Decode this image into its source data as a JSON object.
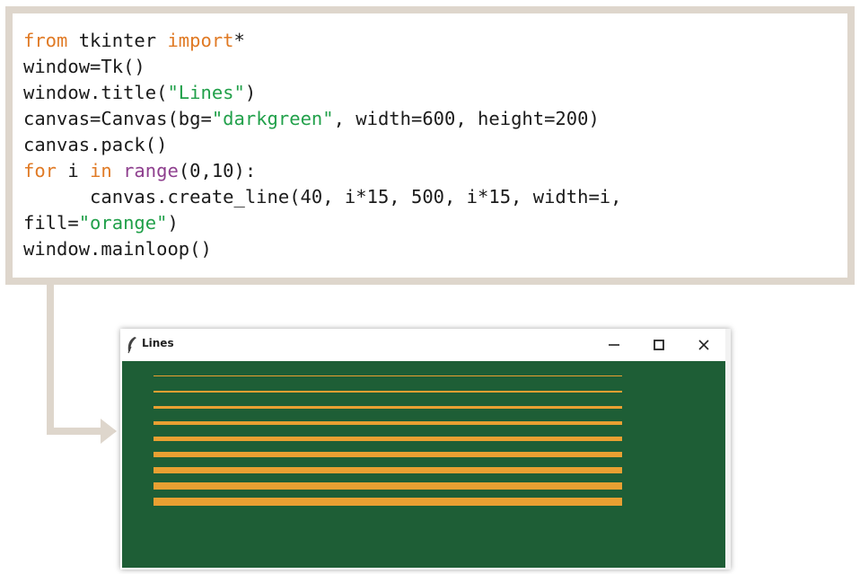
{
  "code": {
    "lines": [
      [
        {
          "t": "from",
          "c": "kw"
        },
        {
          "t": " tkinter "
        },
        {
          "t": "import",
          "c": "kw"
        },
        {
          "t": "*"
        }
      ],
      [
        {
          "t": "window=Tk()"
        }
      ],
      [
        {
          "t": "window.title("
        },
        {
          "t": "\"Lines\"",
          "c": "str"
        },
        {
          "t": ")"
        }
      ],
      [
        {
          "t": "canvas=Canvas(bg="
        },
        {
          "t": "\"darkgreen\"",
          "c": "str"
        },
        {
          "t": ", width=600, height=200)"
        }
      ],
      [
        {
          "t": "canvas.pack()"
        }
      ],
      [
        {
          "t": "for",
          "c": "kw"
        },
        {
          "t": " i "
        },
        {
          "t": "in",
          "c": "kw"
        },
        {
          "t": " "
        },
        {
          "t": "range",
          "c": "fn"
        },
        {
          "t": "(0,10):"
        }
      ],
      [
        {
          "t": "      canvas.create_line(40, i*15, 500, i*15, width=i,"
        }
      ],
      [
        {
          "t": "fill="
        },
        {
          "t": "\"orange\"",
          "c": "str"
        },
        {
          "t": ")"
        }
      ],
      [
        {
          "t": "window.mainloop()"
        }
      ]
    ]
  },
  "window": {
    "title": "Lines",
    "icon": "feather-icon",
    "buttons": {
      "minimize": "minimize-icon",
      "maximize": "maximize-icon",
      "close": "close-icon"
    }
  },
  "canvas": {
    "bg": "#1e5e36",
    "line_color": "#e9a032",
    "lines": [
      {
        "width": 1
      },
      {
        "width": 2
      },
      {
        "width": 3
      },
      {
        "width": 4
      },
      {
        "width": 5
      },
      {
        "width": 6
      },
      {
        "width": 7
      },
      {
        "width": 8
      },
      {
        "width": 9
      }
    ]
  },
  "colors": {
    "keyword": "#e07a25",
    "string": "#21a04a",
    "builtin": "#8e3f8e",
    "frame": "#ded6cc"
  }
}
